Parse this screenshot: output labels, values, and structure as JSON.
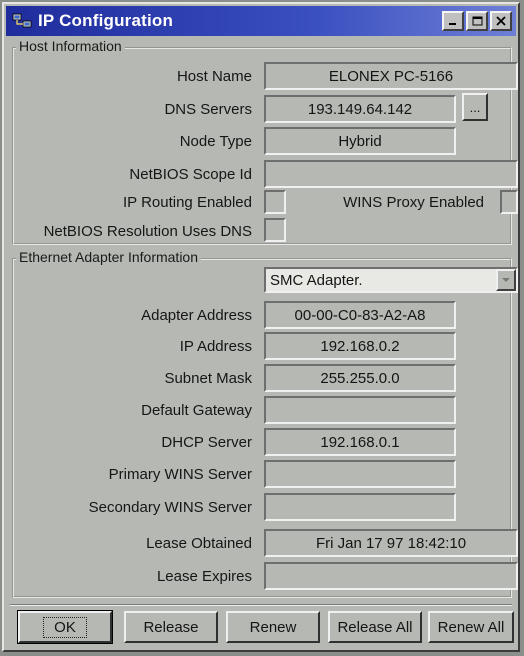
{
  "window": {
    "title": "IP Configuration"
  },
  "host": {
    "legend": "Host Information",
    "host_name_label": "Host Name",
    "host_name": "ELONEX PC-5166",
    "dns_label": "DNS Servers",
    "dns": "193.149.64.142",
    "dns_more": "...",
    "node_type_label": "Node Type",
    "node_type": "Hybrid",
    "scope_label": "NetBIOS Scope Id",
    "scope": "",
    "routing_label": "IP Routing Enabled",
    "wins_proxy_label": "WINS Proxy Enabled",
    "netbios_dns_label": "NetBIOS Resolution Uses DNS"
  },
  "adapter": {
    "legend": "Ethernet  Adapter Information",
    "selected": "SMC Adapter.",
    "address_label": "Adapter Address",
    "address": "00-00-C0-83-A2-A8",
    "ip_label": "IP Address",
    "ip": "192.168.0.2",
    "mask_label": "Subnet Mask",
    "mask": "255.255.0.0",
    "gateway_label": "Default Gateway",
    "gateway": "",
    "dhcp_label": "DHCP Server",
    "dhcp": "192.168.0.1",
    "pwins_label": "Primary WINS Server",
    "pwins": "",
    "swins_label": "Secondary WINS Server",
    "swins": "",
    "lease_obt_label": "Lease Obtained",
    "lease_obt": "Fri Jan 17 97 18:42:10",
    "lease_exp_label": "Lease Expires",
    "lease_exp": ""
  },
  "buttons": {
    "ok": "OK",
    "release": "Release",
    "renew": "Renew",
    "release_all": "Release All",
    "renew_all": "Renew All"
  },
  "icons": {
    "app": "network-computer-icon",
    "minimize": "minimize-icon",
    "maximize": "maximize-icon",
    "close": "close-icon",
    "dropdown": "chevron-down-icon"
  },
  "colors": {
    "title_bar": "#1f2c9c",
    "face": "#b6b9b3"
  }
}
